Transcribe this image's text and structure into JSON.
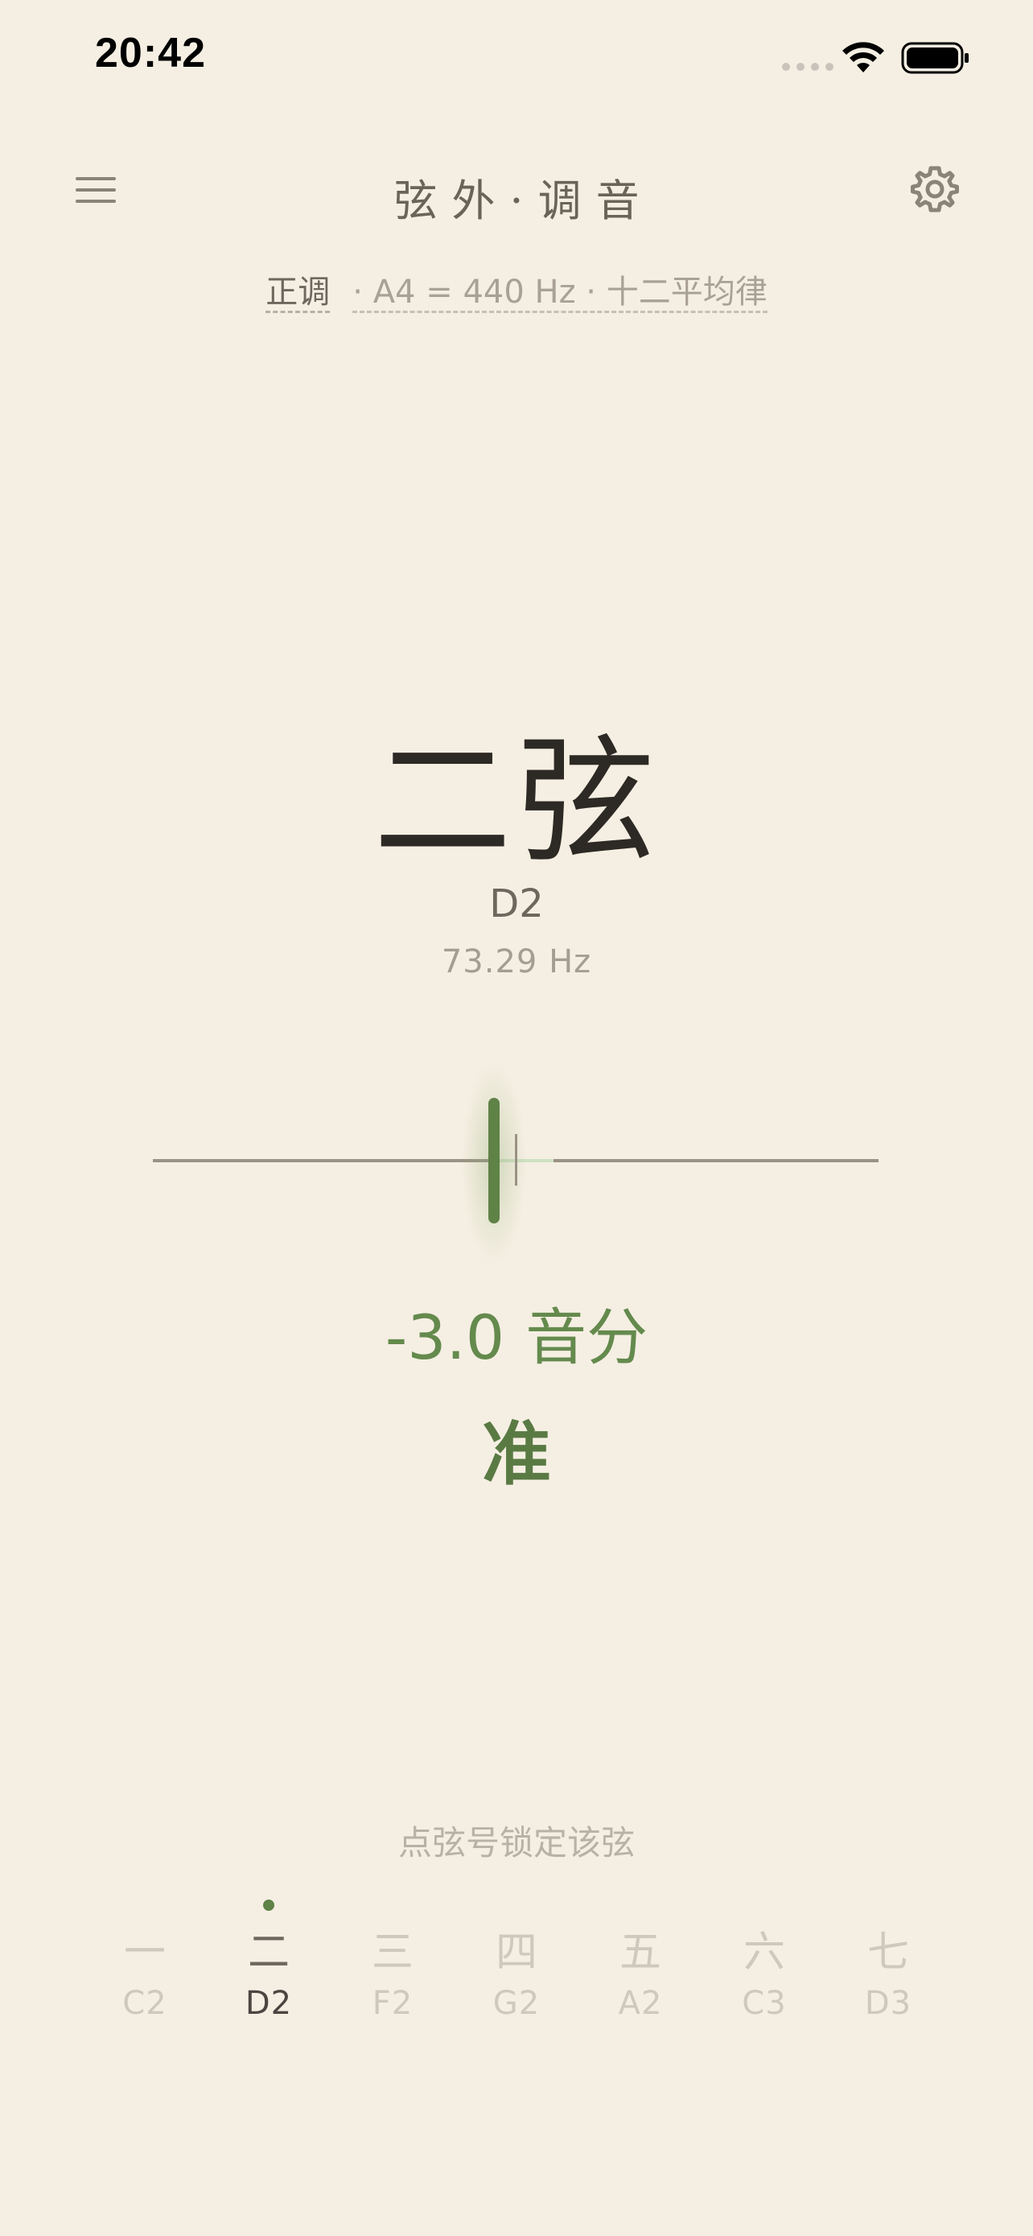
{
  "status_bar": {
    "time": "20:42"
  },
  "header": {
    "title": "弦外·调音",
    "tuning_mode": "正调",
    "reference": "· A4 = 440 Hz · 十二平均律"
  },
  "tuner": {
    "string_name": "二弦",
    "note": "D2",
    "frequency": "73.29 Hz",
    "cents_value": "-3.0",
    "cents_unit": "音分",
    "cents_numeric": -3.0,
    "meter_range_cents": 50,
    "status": "准",
    "accent_color": "#5f8247"
  },
  "strings": {
    "hint": "点弦号锁定该弦",
    "active_index": 1,
    "items": [
      {
        "num": "一",
        "note": "C2"
      },
      {
        "num": "二",
        "note": "D2"
      },
      {
        "num": "三",
        "note": "F2"
      },
      {
        "num": "四",
        "note": "G2"
      },
      {
        "num": "五",
        "note": "A2"
      },
      {
        "num": "六",
        "note": "C3"
      },
      {
        "num": "七",
        "note": "D3"
      }
    ]
  },
  "icons": [
    "menu-icon",
    "gear-icon",
    "wifi-icon",
    "battery-icon",
    "signal-icon"
  ]
}
